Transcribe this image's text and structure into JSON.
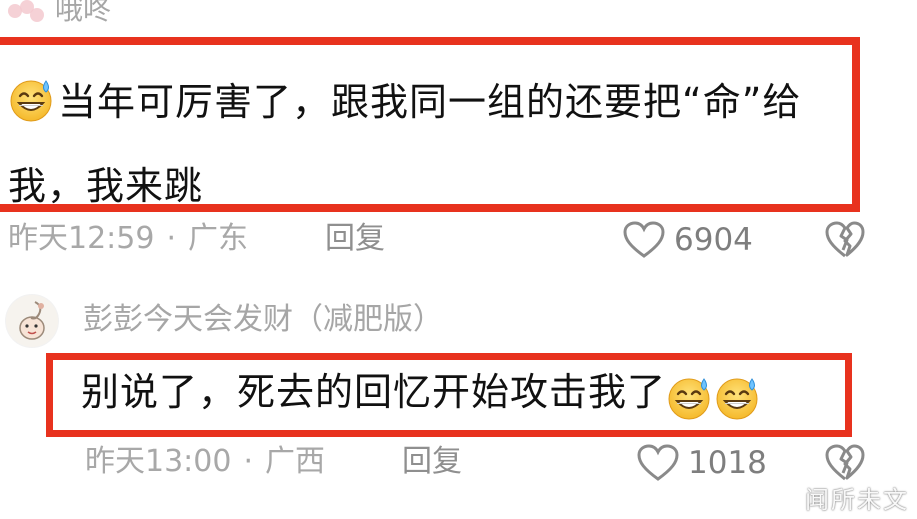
{
  "comments": [
    {
      "username": "哦咚",
      "emoji": "grinning-sweat-emoji",
      "text": "当年可厉害了，跟我同一组的还要把“命”给我，我来跳",
      "time": "昨天12:59",
      "separator": "·",
      "location": "广东",
      "reply_label": "回复",
      "likes": "6904"
    },
    {
      "username": "彭彭今天会发财（减肥版）",
      "text": "别说了，死去的回忆开始攻击我了",
      "trailing_emojis": [
        "grinning-sweat-emoji",
        "grinning-sweat-emoji"
      ],
      "time": "昨天13:00",
      "separator": "·",
      "location": "广西",
      "reply_label": "回复",
      "likes": "1018"
    }
  ],
  "watermark": "闻所未文",
  "colors": {
    "highlight_border": "#e8321e",
    "meta_text": "#a8a8a8",
    "body_text": "#111111"
  }
}
